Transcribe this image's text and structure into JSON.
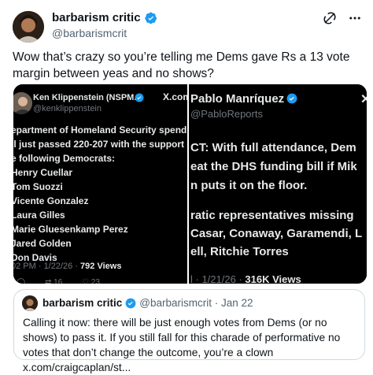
{
  "author": {
    "name": "barbarism critic",
    "handle": "@barbarismcrit"
  },
  "tweet": {
    "text": "Wow that’s crazy so you’re telling me Dems gave Rs a 13 vote margin between yeas and no shows?"
  },
  "media": {
    "left": {
      "name": "Ken Klippenstein (NSPM...",
      "handle": "@kenklippenstein",
      "lines": [
        "epartment of Homeland Security spendin",
        "ll just passed 220-207 with the support o",
        "e following Democrats:",
        "Henry Cuellar",
        "Tom Suozzi",
        "Vicente Gonzalez",
        "Laura Gilles",
        "Marie Gluesenkamp Perez",
        "Jared Golden",
        "Don Davis"
      ],
      "meta_time": "02 PM · 1/22/26 · ",
      "meta_views": "792 Views",
      "actions": [
        "16",
        "23"
      ]
    },
    "right": {
      "logo": "X.com",
      "name": "Pablo Manríquez",
      "handle": "@PabloReports",
      "lines": [
        "CT: With full attendance, Dem",
        "eat the DHS funding bill if Mik",
        "n puts it on the floor.",
        "ratic representatives missing",
        "Casar, Conaway, Garamendi, L",
        "ell, Ritchie Torres"
      ],
      "meta_time": "l · 1/21/26 · ",
      "meta_views": "316K Views"
    }
  },
  "quote": {
    "name": "barbarism critic",
    "handle": "@barbarismcrit · Jan 22",
    "text": "Calling it now: there will be just enough votes from Dems (or no shows) to pass it. If you still fall for this charade of performative no votes that don’t change the outcome, you’re a clown x.com/craigcaplan/st..."
  },
  "colors": {
    "verified": "#1d9bf0",
    "text": "#0f1419",
    "muted": "#536471"
  },
  "icons": [
    "grok-icon",
    "more-icon",
    "verified-icon"
  ]
}
